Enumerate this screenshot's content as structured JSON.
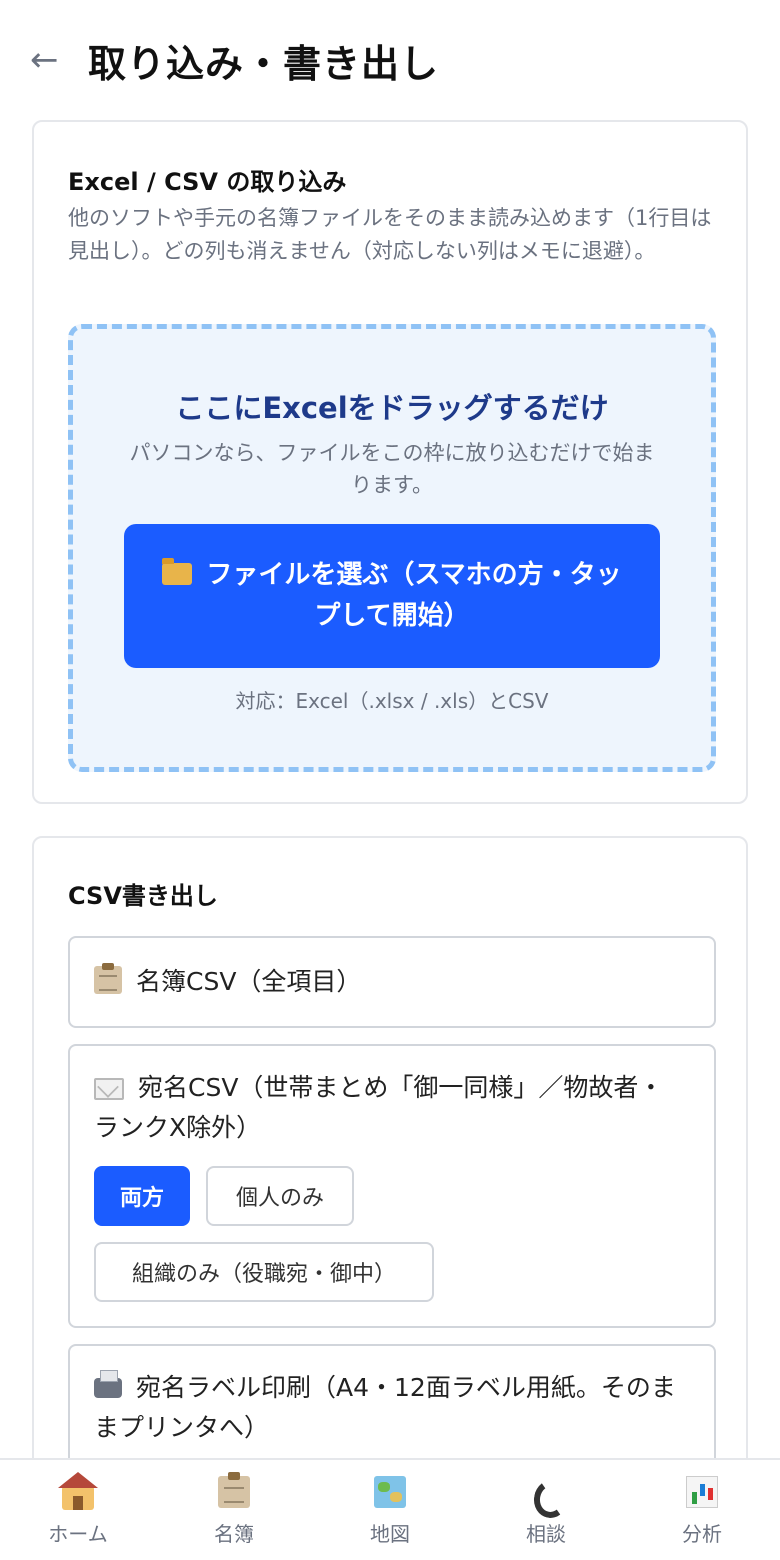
{
  "header": {
    "back_arrow": "←",
    "title": "取り込み・書き出し"
  },
  "import": {
    "title": "Excel / CSV の取り込み",
    "description": "他のソフトや手元の名簿ファイルをそのまま読み込めます（1行目は見出し）。どの列も消えません（対応しない列はメモに退避）。",
    "drop_title": "ここにExcelをドラッグするだけ",
    "drop_subtitle": "パソコンなら、ファイルをこの枠に放り込むだけで始まります。",
    "file_button_label": "ファイルを選ぶ（スマホの方・タップして開始）",
    "file_button_icon": "folder-icon",
    "supported_note": "対応：Excel（.xlsx / .xls）とCSV"
  },
  "export": {
    "title": "CSV書き出し",
    "options": [
      {
        "icon": "clipboard-icon",
        "label": "名簿CSV（全項目）"
      },
      {
        "icon": "envelope-icon",
        "label": "宛名CSV（世帯まとめ「御一同様」／物故者・ランクX除外）"
      },
      {
        "icon": "printer-icon",
        "label": "宛名ラベル印刷（A4・12面ラベル用紙。そのままプリンタへ）"
      }
    ],
    "address_modes": {
      "both": "両方",
      "person_only": "個人のみ",
      "org_only": "組織のみ（役職宛・御中）",
      "selected": "both"
    }
  },
  "nav": {
    "items": [
      {
        "icon": "home-icon",
        "label": "ホーム"
      },
      {
        "icon": "clipboard-icon",
        "label": "名簿"
      },
      {
        "icon": "map-icon",
        "label": "地図"
      },
      {
        "icon": "phone-icon",
        "label": "相談"
      },
      {
        "icon": "chart-icon",
        "label": "分析"
      }
    ]
  },
  "colors": {
    "accent": "#1b5cff",
    "drop_border": "#8fc2f5",
    "drop_bg": "#eef5fd",
    "drop_title": "#1e3a8a"
  }
}
